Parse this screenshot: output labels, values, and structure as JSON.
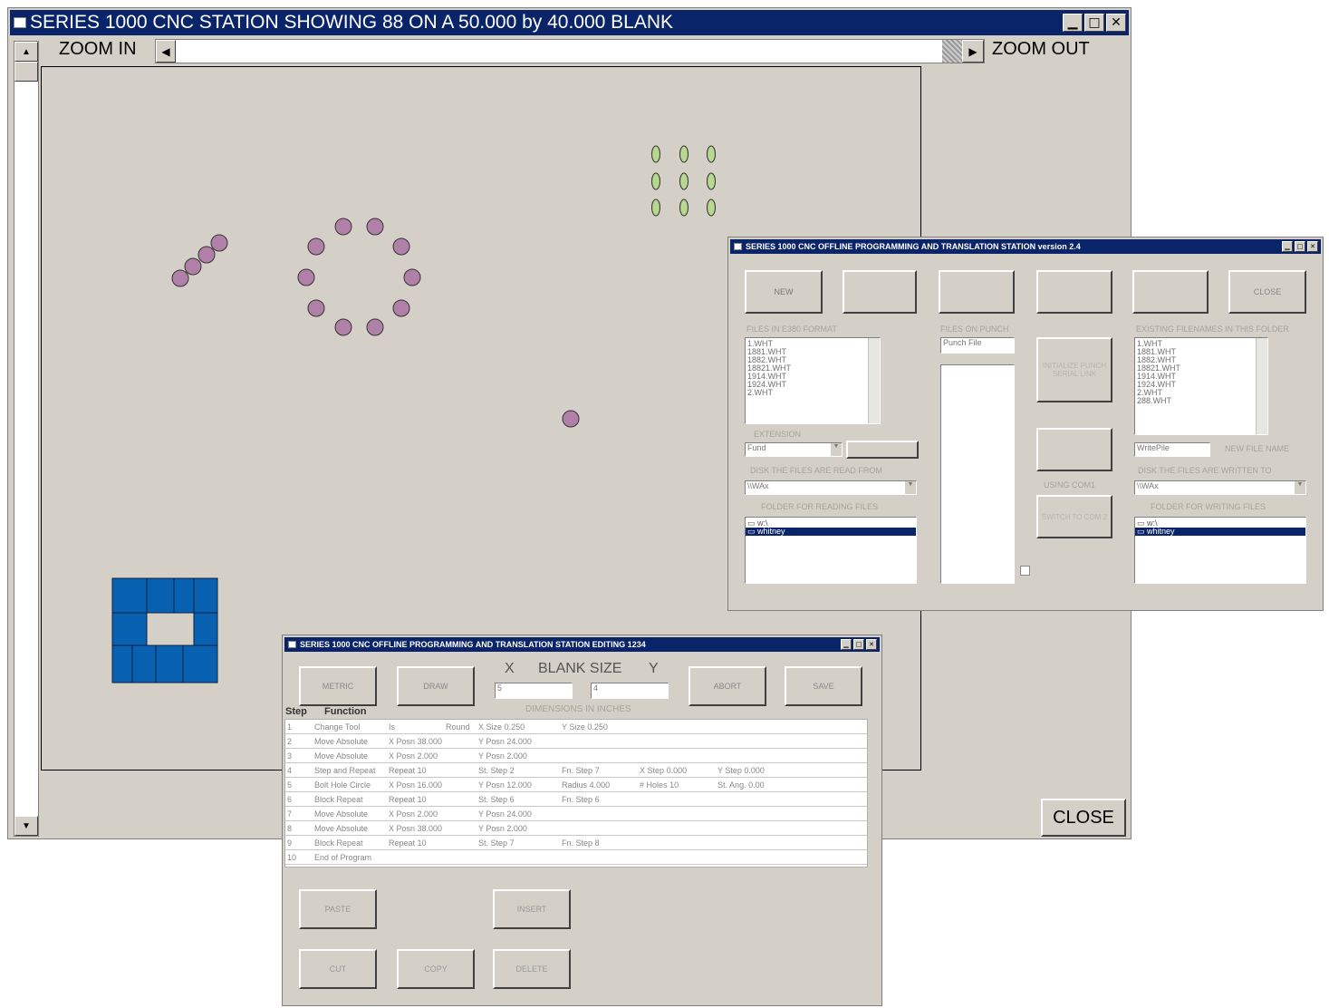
{
  "main_window": {
    "title": "SERIES 1000 CNC STATION SHOWING 88 ON A 50.000 by 40.000 BLANK",
    "zoom_in_label": "ZOOM IN",
    "zoom_out_label": "ZOOM OUT",
    "close_label": "CLOSE",
    "colors": {
      "title_bar": "#0a246a",
      "canvas": "#d4d0c8",
      "small_holes": "#b080a8",
      "slot_holes": "#b8d890",
      "square_tool": "#0860b0"
    }
  },
  "offline_window": {
    "title": "SERIES 1000 CNC OFFLINE PROGRAMMING AND TRANSLATION STATION version 2.4",
    "buttons": [
      "NEW",
      "",
      "",
      "",
      "",
      "CLOSE"
    ],
    "files_label": "FILES IN E380 FORMAT",
    "files": [
      "1.WHT",
      "1881.WHT",
      "1882.WHT",
      "18821.WHT",
      "1914.WHT",
      "1924.WHT",
      "2.WHT"
    ],
    "files_punch_label": "FILES ON PUNCH",
    "punch_file": "Punch File",
    "init_punch_label": "INITIALIZE PUNCH SERIAL LINK",
    "existing_label": "EXISTING FILENAMES IN THIS FOLDER",
    "existing_files": [
      "1.WHT",
      "1881.WHT",
      "1882.WHT",
      "18821.WHT",
      "1914.WHT",
      "1924.WHT",
      "2.WHT",
      "288.WHT"
    ],
    "extension_label": "EXTENSION",
    "extension_value": "Fund",
    "new_file_label": "NEW FILE NAME",
    "new_file_value": "WritePile",
    "disk_read_label": "DISK THE FILES ARE READ FROM",
    "disk_read_value": "\\\\WAx",
    "disk_write_label": "DISK THE FILES ARE WRITTEN TO",
    "disk_write_value": "\\\\WAx",
    "using_label": "USING COM1",
    "switch_label": "SWITCH TO COM 2",
    "folder_read_label": "FOLDER FOR READING FILES",
    "folder_write_label": "FOLDER FOR WRITING FILES",
    "folder_items": [
      "w:\\",
      "whitney"
    ]
  },
  "edit_window": {
    "title": "SERIES 1000 CNC OFFLINE PROGRAMMING AND TRANSLATION STATION EDITING 1234",
    "metric_label": "METRIC",
    "draw_label": "DRAW",
    "abort_label": "ABORT",
    "save_label": "SAVE",
    "x_label": "X",
    "blank_size_label": "BLANK SIZE",
    "y_label": "Y",
    "x_value": "5",
    "y_value": "4",
    "dims_label": "DIMENSIONS IN INCHES",
    "col_step": "Step",
    "col_function": "Function",
    "rows": [
      [
        "1",
        "Change Tool",
        "Is",
        "Round",
        "X Size  0.250",
        "Y Size  0.250",
        "",
        "",
        ""
      ],
      [
        "2",
        "Move Absolute",
        "X Posn  38.000",
        "",
        "Y Posn  24.000",
        "",
        "",
        "",
        ""
      ],
      [
        "3",
        "Move Absolute",
        "X Posn  2.000",
        "",
        "Y Posn  2.000",
        "",
        "",
        "",
        ""
      ],
      [
        "4",
        "Step and Repeat",
        "Repeat  10",
        "",
        "St. Step 2",
        "Fn. Step 7",
        "X Step  0.000",
        "Y Step  0.000",
        ""
      ],
      [
        "5",
        "Bolt Hole Circle",
        "X Posn  16.000",
        "",
        "Y Posn  12.000",
        "Radius  4.000",
        "# Holes  10",
        "St. Ang. 0.00",
        ""
      ],
      [
        "6",
        "Block Repeat",
        "Repeat  10",
        "",
        "St. Step 6",
        "Fn. Step 6",
        "",
        "",
        ""
      ],
      [
        "7",
        "Move Absolute",
        "X Posn  2.000",
        "",
        "Y Posn  24.000",
        "",
        "",
        "",
        ""
      ],
      [
        "8",
        "Move Absolute",
        "X Posn  38.000",
        "",
        "Y Posn  2.000",
        "",
        "",
        "",
        ""
      ],
      [
        "9",
        "Block Repeat",
        "Repeat  10",
        "",
        "St. Step 7",
        "Fn. Step 8",
        "",
        "",
        ""
      ],
      [
        "10",
        "End of Program",
        "",
        "",
        "",
        "",
        "",
        "",
        ""
      ]
    ],
    "paste_label": "PASTE",
    "insert_label": "INSERT",
    "cut_label": "CUT",
    "copy_label": "COPY",
    "delete_label": "DELETE"
  }
}
